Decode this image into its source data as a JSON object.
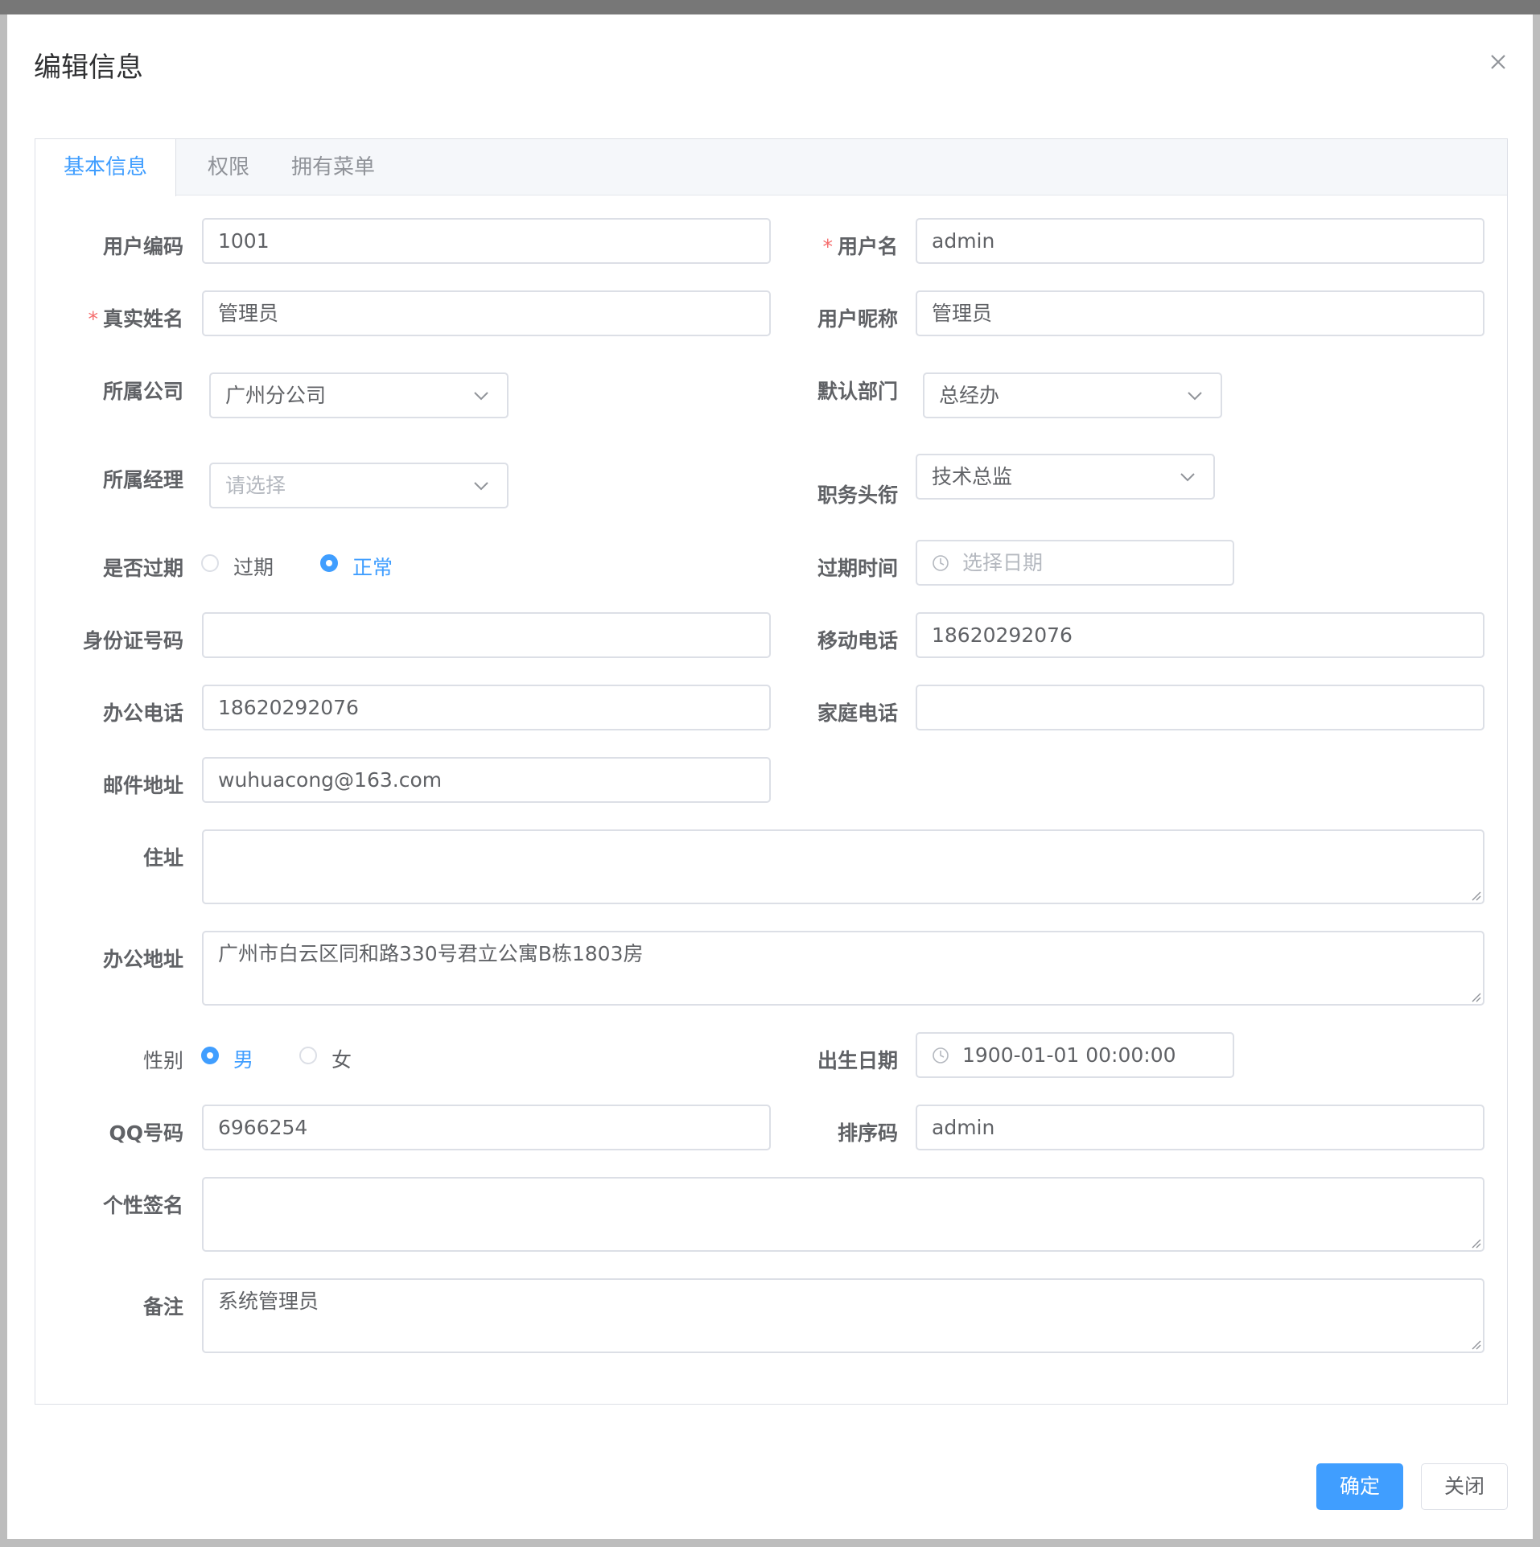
{
  "dialog": {
    "title": "编辑信息"
  },
  "tabs": [
    {
      "label": "基本信息"
    },
    {
      "label": "权限"
    },
    {
      "label": "拥有菜单"
    }
  ],
  "form": {
    "user_code": {
      "label": "用户编码",
      "value": "1001"
    },
    "username": {
      "label": "用户名",
      "value": "admin",
      "required_mark": "*"
    },
    "real_name": {
      "label": "真实姓名",
      "value": "管理员",
      "required_mark": "*"
    },
    "nickname": {
      "label": "用户昵称",
      "value": "管理员"
    },
    "company": {
      "label": "所属公司",
      "value": "广州分公司"
    },
    "department": {
      "label": "默认部门",
      "value": "总经办"
    },
    "manager": {
      "label": "所属经理",
      "placeholder": "请选择"
    },
    "job_title": {
      "label": "职务头衔",
      "value": "技术总监"
    },
    "expired": {
      "label": "是否过期",
      "options": [
        "过期",
        "正常"
      ],
      "selected": "正常"
    },
    "expire_time": {
      "label": "过期时间",
      "placeholder": "选择日期"
    },
    "id_number": {
      "label": "身份证号码",
      "value": ""
    },
    "mobile": {
      "label": "移动电话",
      "value": "18620292076"
    },
    "office_phone": {
      "label": "办公电话",
      "value": "18620292076"
    },
    "home_phone": {
      "label": "家庭电话",
      "value": ""
    },
    "email": {
      "label": "邮件地址",
      "value": "wuhuacong@163.com"
    },
    "address": {
      "label": "住址",
      "value": ""
    },
    "office_address": {
      "label": "办公地址",
      "value": "广州市白云区同和路330号君立公寓B栋1803房"
    },
    "gender": {
      "label": "性别",
      "options": [
        "男",
        "女"
      ],
      "selected": "男"
    },
    "birthday": {
      "label": "出生日期",
      "value": "1900-01-01 00:00:00"
    },
    "qq": {
      "label": "QQ号码",
      "value": "6966254"
    },
    "sort_code": {
      "label": "排序码",
      "value": "admin"
    },
    "signature": {
      "label": "个性签名",
      "value": ""
    },
    "remark": {
      "label": "备注",
      "value": "系统管理员"
    }
  },
  "footer": {
    "confirm_label": "确定",
    "close_label": "关闭"
  },
  "colors": {
    "primary": "#409eff",
    "required": "#f56c6c",
    "border": "#dcdfe6",
    "text": "#606266",
    "placeholder": "#b4b8bf"
  },
  "icons": [
    "close-icon",
    "chevron-down-icon",
    "clock-icon",
    "resize-grip-icon"
  ]
}
